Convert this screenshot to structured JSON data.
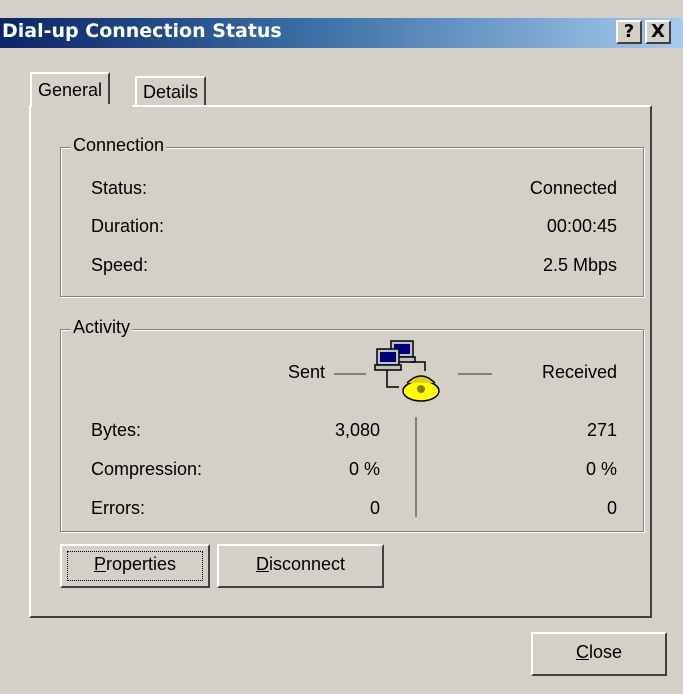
{
  "window": {
    "title": "Dial-up Connection Status"
  },
  "titlebar_buttons": {
    "help": "?",
    "close": "X"
  },
  "tabs": [
    {
      "label": "General",
      "selected": true
    },
    {
      "label": "Details",
      "selected": false
    }
  ],
  "connection": {
    "group_label": "Connection",
    "rows": [
      {
        "label": "Status:",
        "value": "Connected"
      },
      {
        "label": "Duration:",
        "value": "00:00:45"
      },
      {
        "label": "Speed:",
        "value": "2.5 Mbps"
      }
    ]
  },
  "activity": {
    "group_label": "Activity",
    "sent_label": "Sent",
    "received_label": "Received",
    "rows": [
      {
        "label": "Bytes:",
        "sent": "3,080",
        "received": "271"
      },
      {
        "label": "Compression:",
        "sent": "0 %",
        "received": "0 %"
      },
      {
        "label": "Errors:",
        "sent": "0",
        "received": "0"
      }
    ]
  },
  "buttons": {
    "properties": {
      "first": "P",
      "rest": "roperties"
    },
    "disconnect": {
      "first": "D",
      "rest": "isconnect"
    },
    "close": {
      "first": "C",
      "rest": "lose"
    }
  },
  "icon": "network-computers-phone-icon"
}
